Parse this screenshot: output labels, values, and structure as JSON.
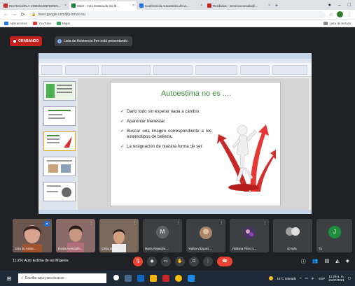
{
  "browser": {
    "tabs": [
      {
        "label": "INVITACIÓN A VIDEOCONFEREN...",
        "color": "#c62828",
        "active": false
      },
      {
        "label": "Meet - Auto Estima de las M...",
        "color": "#188038",
        "active": true
      },
      {
        "label": "Conferencia Autoestima de la...",
        "color": "#1a73e8",
        "active": false
      },
      {
        "label": "Recibidos - servicioconsulta@...",
        "color": "#c5221f",
        "active": false
      }
    ],
    "new_tab": "+",
    "url": "meet.google.com/jky-mhzx-nsi",
    "bookmarks": [
      {
        "label": "Aplicaciones",
        "color": "#1a73e8"
      },
      {
        "label": "YouTube",
        "color": "#e53935"
      },
      {
        "label": "Maps",
        "color": "#34a853"
      }
    ],
    "reading_list": "Lista de lectura"
  },
  "meet": {
    "recording_label": "GRABANDO",
    "presenting_label": "Lista de Asistencia Ihm está presentando",
    "meeting_time": "11:29",
    "meeting_name": "Auto Estima de las Mujeres"
  },
  "slide": {
    "title": "Autoestima no es ....",
    "bullets": [
      "Darlo todo sin esperar nada a cambio.",
      "Aparentar bienestar.",
      "Buscar una imagen correspondiente a los estereotipos de belleza.",
      "La resignación de nuestra forma de ser."
    ],
    "check_glyph": "✓",
    "title_color": "#3f8a3a"
  },
  "participants": [
    {
      "name": "Lista de Asiste...",
      "type": "photo",
      "color": "#b97868"
    },
    {
      "name": "Rosita Avendaño...",
      "type": "photo",
      "color": "#8a6a66"
    },
    {
      "name": "Cintia de Lu...",
      "type": "photo",
      "color": "#7a6a5c"
    },
    {
      "name": "María Alejandra ...",
      "type": "initial",
      "initial": "M",
      "color": "#5f6368"
    },
    {
      "name": "Yadira Vázquez ...",
      "type": "photo",
      "color": "#a9856b"
    },
    {
      "name": "Viridiana Pérez L...",
      "type": "photo",
      "color": "#4a3560"
    },
    {
      "name": "40 más",
      "type": "more",
      "color": "#3c4043"
    },
    {
      "name": "Tú",
      "type": "initial",
      "initial": "J",
      "color": "#1e8e3e"
    }
  ],
  "taskbar": {
    "search_placeholder": "Escribe aquí para buscar",
    "weather": "16°C Soleado",
    "lang": "ESP",
    "time": "11:29 a. m.",
    "date": "21/07/2021"
  }
}
